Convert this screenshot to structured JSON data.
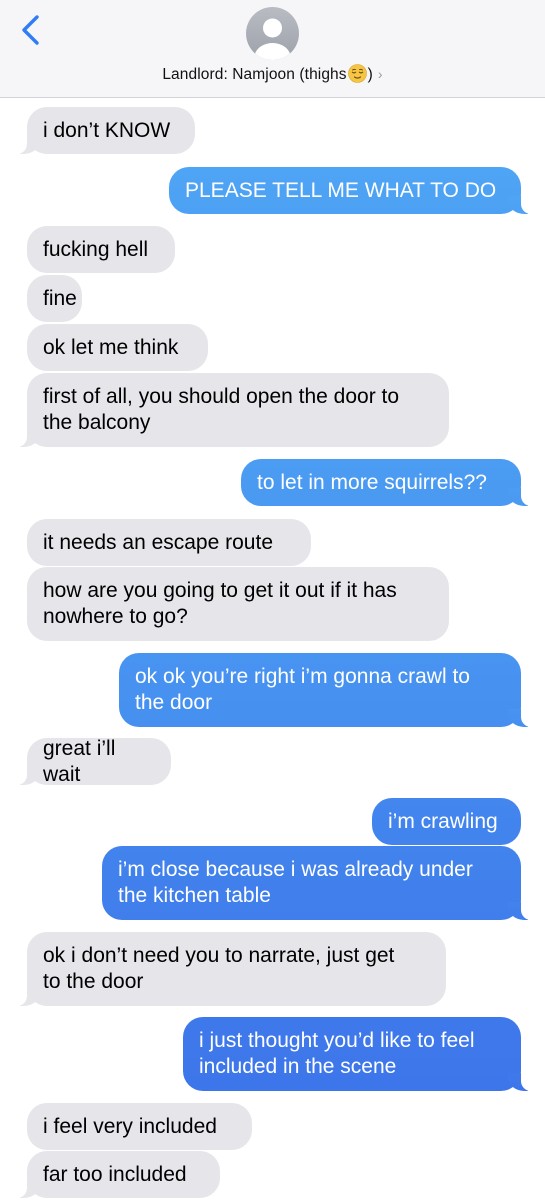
{
  "header": {
    "contact_name": "Landlord: Namjoon (thighs",
    "contact_name_suffix": ")",
    "emoji_icon": "relieved-face-emoji",
    "chevron": "›"
  },
  "colors": {
    "received_bubble": "#e5e5ea",
    "sent_bubble_top": "#4fa6f5",
    "sent_bubble_bottom": "#3d76ea",
    "ios_blue": "#2f7cf6"
  },
  "messages": [
    {
      "dir": "received",
      "text": "i don’t KNOW"
    },
    {
      "dir": "sent",
      "text": "PLEASE TELL ME WHAT TO DO"
    },
    {
      "dir": "received",
      "text": "fucking hell"
    },
    {
      "dir": "received",
      "text": "fine"
    },
    {
      "dir": "received",
      "text": "ok let me think"
    },
    {
      "dir": "received",
      "text": "first of all, you should open the door to\nthe balcony"
    },
    {
      "dir": "sent",
      "text": "to let in more squirrels??"
    },
    {
      "dir": "received",
      "text": "it needs an escape route"
    },
    {
      "dir": "received",
      "text": "how are you going to get it out if it has\nnowhere to go?"
    },
    {
      "dir": "sent",
      "text": "ok ok you’re right i’m gonna crawl to\nthe door"
    },
    {
      "dir": "received",
      "text": "great i’ll wait"
    },
    {
      "dir": "sent",
      "text": "i’m crawling"
    },
    {
      "dir": "sent",
      "text": "i’m close because i was already under\nthe kitchen table"
    },
    {
      "dir": "received",
      "text": "ok i don’t need you to narrate, just get\nto the door"
    },
    {
      "dir": "sent",
      "text": "i just thought you’d like to feel\nincluded in the scene"
    },
    {
      "dir": "received",
      "text": "i feel very included"
    },
    {
      "dir": "received",
      "text": "far too included"
    }
  ]
}
